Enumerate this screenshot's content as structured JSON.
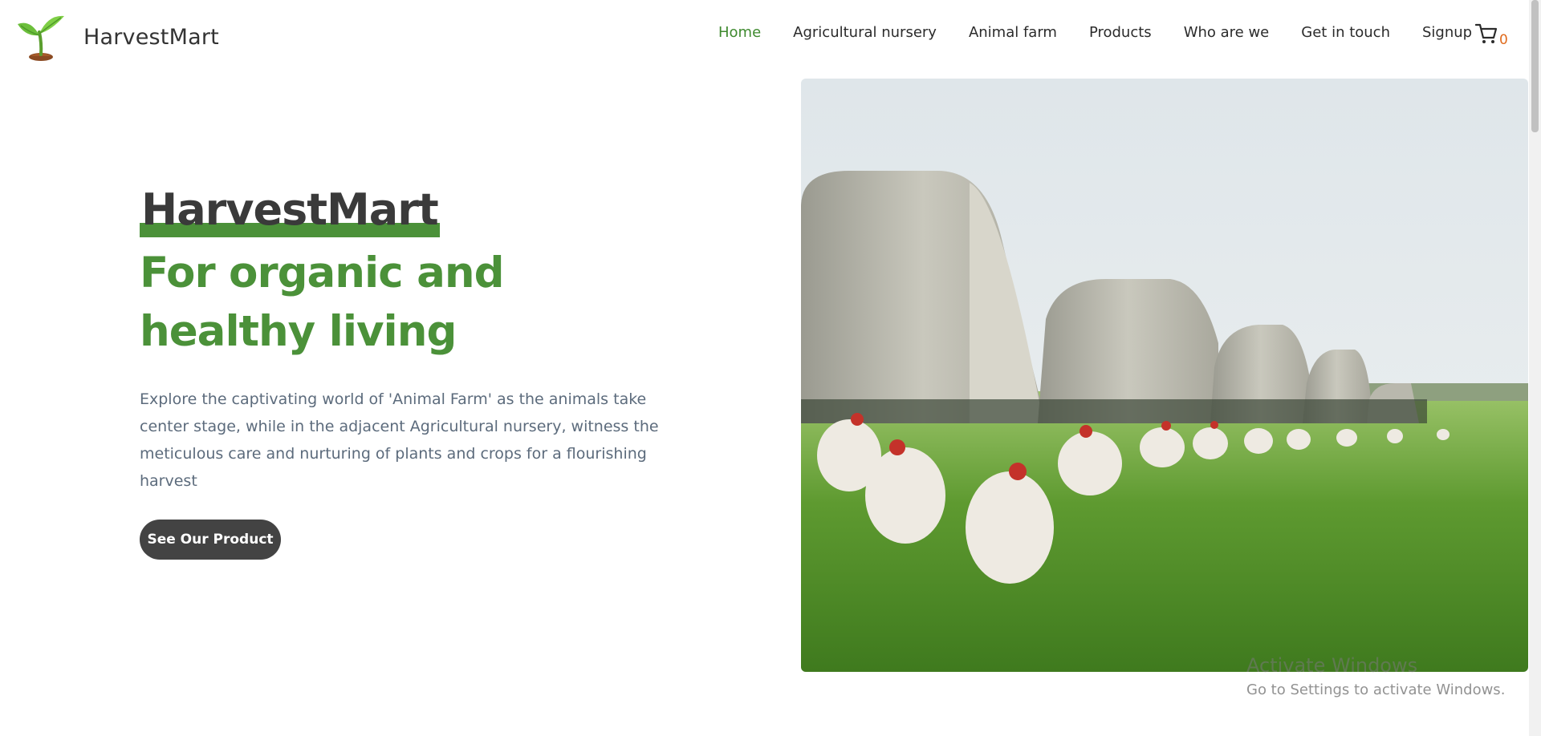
{
  "brand": {
    "name": "HarvestMart",
    "logo_icon": "sprout-icon"
  },
  "nav": {
    "items": [
      {
        "label": "Home",
        "active": true
      },
      {
        "label": "Agricultural nursery",
        "active": false
      },
      {
        "label": "Animal farm",
        "active": false
      },
      {
        "label": "Products",
        "active": false
      },
      {
        "label": "Who are we",
        "active": false
      },
      {
        "label": "Get in touch",
        "active": false
      },
      {
        "label": "Signup",
        "active": false
      }
    ],
    "cart": {
      "icon": "cart-icon",
      "count": "0"
    }
  },
  "hero": {
    "title": "HarvestMart",
    "subtitle": "For organic and healthy living",
    "description": "Explore the captivating world of 'Animal Farm' as the animals take center stage, while in the adjacent Agricultural nursery, witness the meticulous care and nurturing of plants and crops for a flourishing harvest",
    "cta_label": "See Our Product"
  },
  "watermark": {
    "line1": "Activate Windows",
    "line2": "Go to Settings to activate Windows."
  },
  "colors": {
    "accent_green": "#4b9139",
    "nav_active": "#3f8a2f",
    "button_dark": "#434343",
    "cart_count": "#e06a1c",
    "desc_text": "#5c6b7c"
  }
}
